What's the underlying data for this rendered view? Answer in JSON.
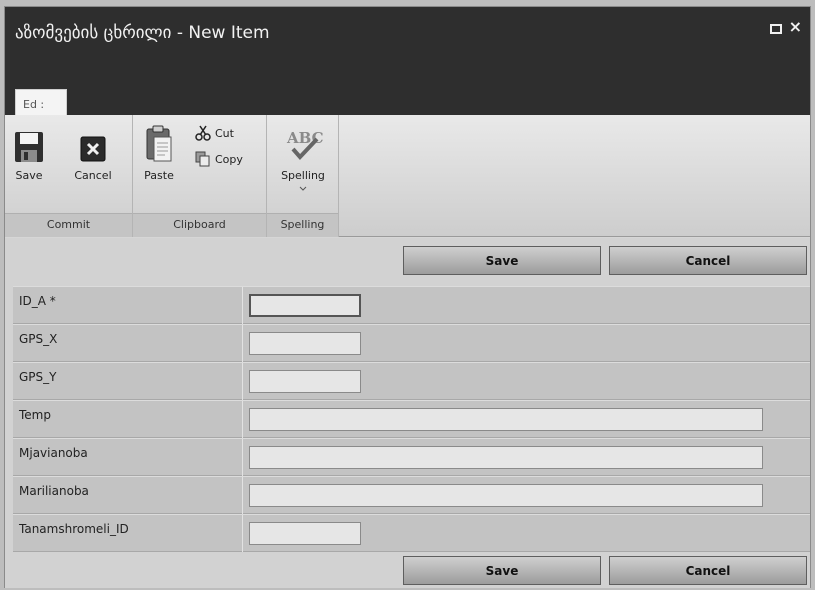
{
  "window": {
    "title": "აზომვების ცხრილი - New Item",
    "maximize_icon": "maximize-icon",
    "close_icon": "close-icon",
    "close_glyph": "×"
  },
  "tabs": [
    {
      "label": "Ed :",
      "active": true
    }
  ],
  "ribbon": {
    "groups": [
      {
        "label": "Commit",
        "buttons": [
          {
            "label": "Save",
            "icon": "floppy-disk-icon"
          },
          {
            "label": "Cancel",
            "icon": "cancel-x-icon"
          }
        ]
      },
      {
        "label": "Clipboard",
        "buttons": [
          {
            "label": "Paste",
            "icon": "clipboard-icon"
          },
          {
            "label": "Cut",
            "icon": "scissors-icon"
          },
          {
            "label": "Copy",
            "icon": "copy-icon"
          }
        ]
      },
      {
        "label": "Spelling",
        "buttons": [
          {
            "label": "Spelling",
            "icon": "abc-check-icon"
          }
        ]
      }
    ]
  },
  "form": {
    "top_buttons": {
      "save": "Save",
      "cancel": "Cancel"
    },
    "bottom_buttons": {
      "save": "Save",
      "cancel": "Cancel"
    },
    "fields": [
      {
        "label": "ID_A *",
        "value": ""
      },
      {
        "label": "GPS_X",
        "value": ""
      },
      {
        "label": "GPS_Y",
        "value": ""
      },
      {
        "label": "Temp",
        "value": ""
      },
      {
        "label": "Mjavianoba",
        "value": ""
      },
      {
        "label": "Marilianoba",
        "value": ""
      },
      {
        "label": "Tanamshromeli_ID",
        "value": ""
      }
    ]
  },
  "colors": {
    "title_bar": "#2e2e2e",
    "ribbon": "#dedede",
    "form_background": "#d2d2d2",
    "cancel_icon_bg": "#2b2b2b"
  }
}
